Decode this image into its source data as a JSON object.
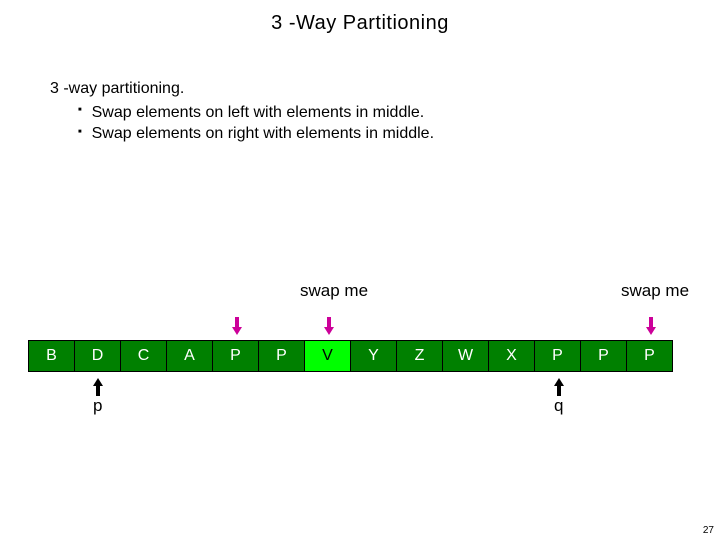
{
  "title": "3 -Way Partitioning",
  "heading": "3 -way partitioning.",
  "bullets": [
    "Swap elements on left with elements in middle.",
    "Swap elements on right with elements in middle."
  ],
  "swap_label_left": "swap me",
  "swap_label_right": "swap me",
  "cells": [
    "B",
    "D",
    "C",
    "A",
    "P",
    "P",
    "V",
    "Y",
    "Z",
    "W",
    "X",
    "P",
    "P",
    "P"
  ],
  "highlight_index": 6,
  "pointers": {
    "p": "p",
    "q": "q"
  },
  "colors": {
    "cell_bg": "#008000",
    "cell_fg": "#ffffff",
    "highlight_bg": "#00ff00",
    "highlight_fg": "#000000",
    "arrow_top": "#cc0099",
    "arrow_bottom": "#000000"
  },
  "page_number": "27"
}
